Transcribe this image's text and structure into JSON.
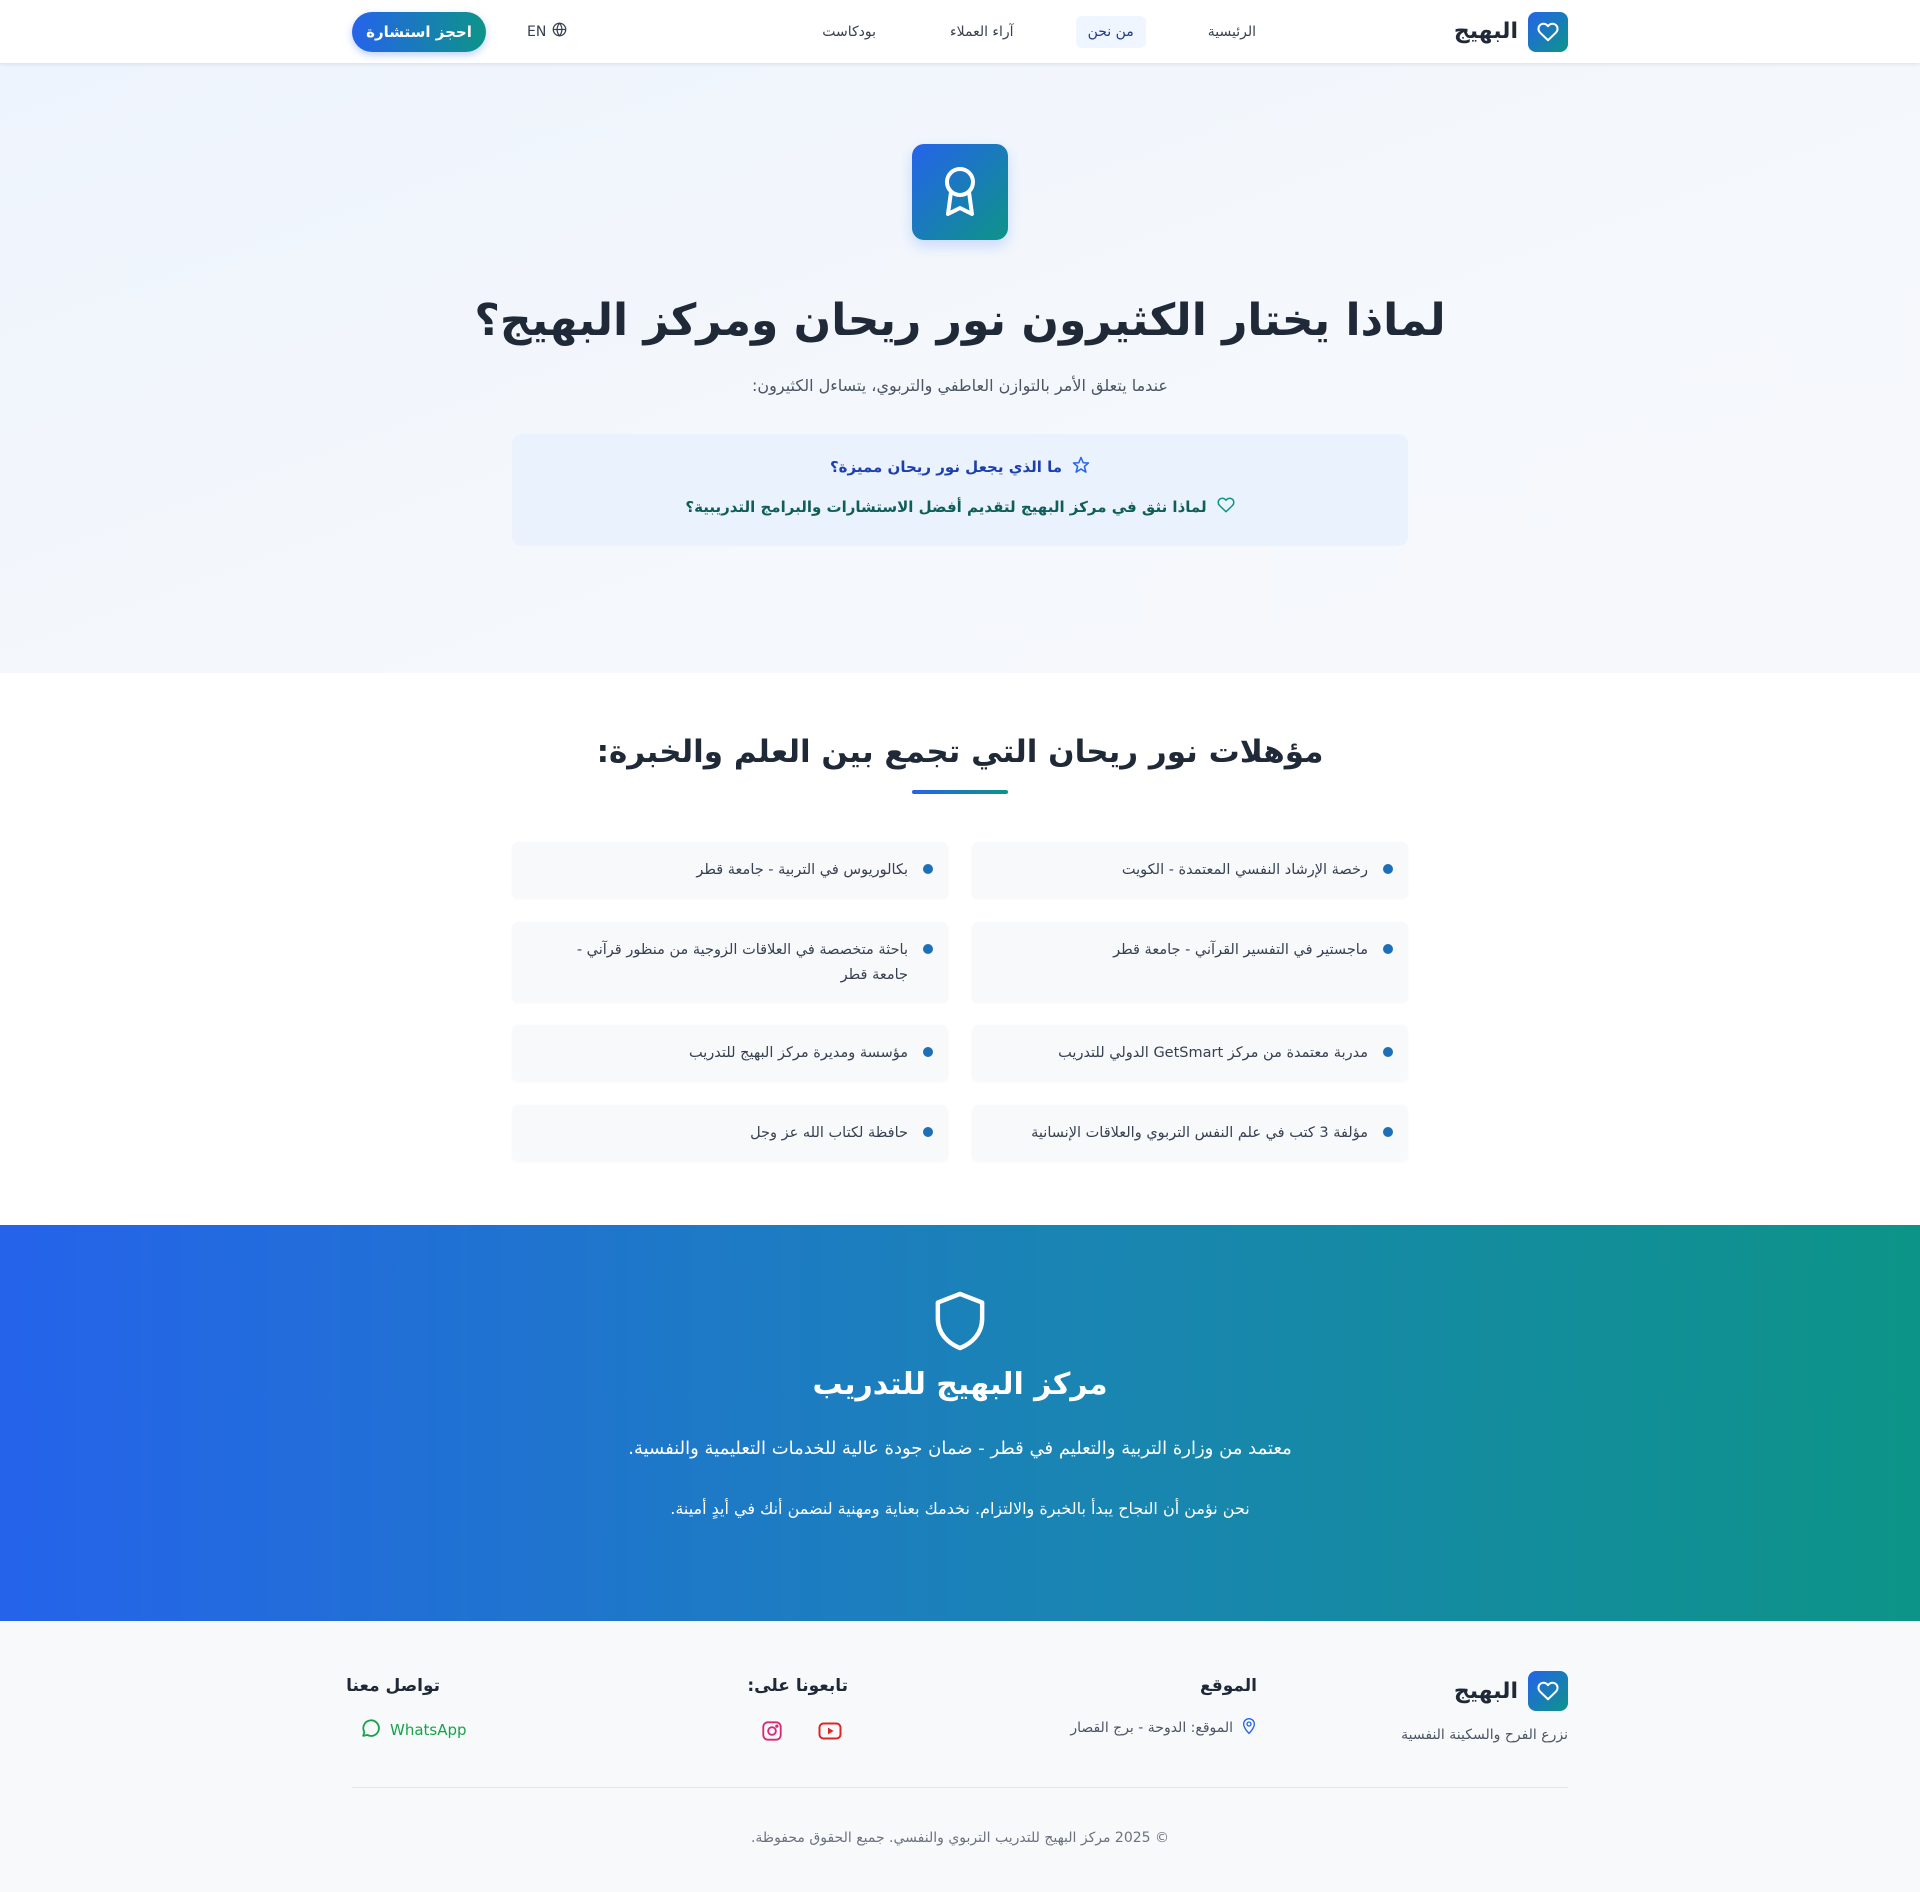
{
  "header": {
    "brand": "البهيج",
    "nav": [
      "الرئيسية",
      "من نحن",
      "آراء العملاء",
      "بودكاست"
    ],
    "active_nav": "من نحن",
    "lang": "EN",
    "cta": "احجز استشارة"
  },
  "hero": {
    "title": "لماذا يختار الكثيرون نور ريحان ومركز البهيج؟",
    "subtitle": "عندما يتعلق الأمر بالتوازن العاطفي والتربوي، يتساءل الكثيرون:",
    "q1": "ما الذي يجعل نور ريحان مميزة؟",
    "q2": "لماذا نثق في مركز البهيج لتقديم أفضل الاستشارات والبرامج التدريبية؟"
  },
  "qualifications": {
    "title": "مؤهلات نور ريحان التي تجمع بين العلم والخبرة:",
    "items": [
      "رخصة الإرشاد النفسي المعتمدة - الكويت",
      "بكالوريوس في التربية - جامعة قطر",
      "ماجستير في التفسير القرآني - جامعة قطر",
      "باحثة متخصصة في العلاقات الزوجية من منظور قرآني - جامعة قطر",
      "مدربة معتمدة من مركز GetSmart الدولي للتدريب",
      "مؤسسة ومديرة مركز البهيج للتدريب",
      "مؤلفة 3 كتب في علم النفس التربوي والعلاقات الإنسانية",
      "حافظة لكتاب الله عز وجل"
    ]
  },
  "accreditation": {
    "title": "مركز البهيج للتدريب",
    "text1": "معتمد من وزارة التربية والتعليم في قطر - ضمان جودة عالية للخدمات التعليمية والنفسية.",
    "text2": "نحن نؤمن أن النجاح يبدأ بالخبرة والالتزام. نخدمك بعناية ومهنية لنضمن أنك في أيدٍ أمينة."
  },
  "footer": {
    "brand": "البهيج",
    "tagline": "نزرع الفرح والسكينة النفسية",
    "location_title": "الموقع",
    "location_text": "الموقع: الدوحة - برج القصار",
    "follow_title": "تابعونا على:",
    "contact_title": "تواصل معنا",
    "whatsapp": "WhatsApp",
    "copyright": "© 2025 مركز البهيج للتدريب التربوي والنفسي. جميع الحقوق محفوظة."
  },
  "colors": {
    "primary": "#2563eb",
    "teal": "#0d9488",
    "whatsapp": "#16a34a",
    "youtube": "#dc2626",
    "instagram": "#db2777"
  }
}
